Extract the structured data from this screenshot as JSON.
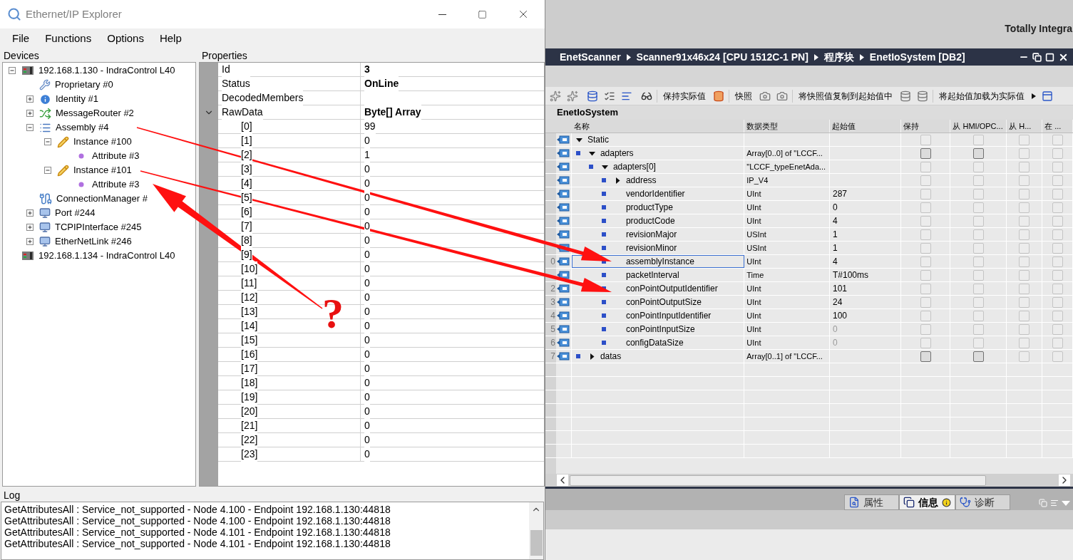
{
  "explorer": {
    "title": "Ethernet/IP Explorer",
    "menu": [
      "File",
      "Functions",
      "Options",
      "Help"
    ],
    "devices_label": "Devices",
    "properties_label": "Properties",
    "tree": [
      {
        "label": "192.168.1.130 - IndraControl L40",
        "kind": "device",
        "expanded": true,
        "children": [
          {
            "label": "Proprietary #0",
            "kind": "wrench"
          },
          {
            "label": "Identity #1",
            "kind": "info",
            "expanded": false
          },
          {
            "label": "MessageRouter #2",
            "kind": "router",
            "expanded": false
          },
          {
            "label": "Assembly #4",
            "kind": "list",
            "expanded": true,
            "children": [
              {
                "label": "Instance #100",
                "kind": "pencil",
                "expanded": true,
                "children": [
                  {
                    "label": "Attribute #3",
                    "kind": "dot"
                  }
                ]
              },
              {
                "label": "Instance #101",
                "kind": "pencil",
                "expanded": true,
                "children": [
                  {
                    "label": "Attribute #3",
                    "kind": "dot"
                  }
                ]
              }
            ]
          },
          {
            "label": "ConnectionManager #",
            "kind": "cable"
          },
          {
            "label": "Port #244",
            "kind": "monitor",
            "expanded": false
          },
          {
            "label": "TCPIPInterface #245",
            "kind": "monitor",
            "expanded": false
          },
          {
            "label": "EtherNetLink #246",
            "kind": "monitor",
            "expanded": false
          }
        ]
      },
      {
        "label": "192.168.1.134 - IndraControl L40",
        "kind": "device"
      }
    ],
    "properties": [
      {
        "name": "Id",
        "value": "3",
        "bold": true
      },
      {
        "name": "Status",
        "value": "OnLine",
        "bold": true
      },
      {
        "name": "DecodedMembers"
      },
      {
        "name": "RawData",
        "value": "Byte[] Array",
        "bold": true,
        "expanded": true,
        "children": [
          {
            "name": "[0]",
            "value": "99"
          },
          {
            "name": "[1]",
            "value": "0"
          },
          {
            "name": "[2]",
            "value": "1"
          },
          {
            "name": "[3]",
            "value": "0"
          },
          {
            "name": "[4]",
            "value": "0"
          },
          {
            "name": "[5]",
            "value": "0"
          },
          {
            "name": "[6]",
            "value": "0"
          },
          {
            "name": "[7]",
            "value": "0"
          },
          {
            "name": "[8]",
            "value": "0"
          },
          {
            "name": "[9]",
            "value": "0"
          },
          {
            "name": "[10]",
            "value": "0"
          },
          {
            "name": "[11]",
            "value": "0"
          },
          {
            "name": "[12]",
            "value": "0"
          },
          {
            "name": "[13]",
            "value": "0"
          },
          {
            "name": "[14]",
            "value": "0"
          },
          {
            "name": "[15]",
            "value": "0"
          },
          {
            "name": "[16]",
            "value": "0"
          },
          {
            "name": "[17]",
            "value": "0"
          },
          {
            "name": "[18]",
            "value": "0"
          },
          {
            "name": "[19]",
            "value": "0"
          },
          {
            "name": "[20]",
            "value": "0"
          },
          {
            "name": "[21]",
            "value": "0"
          },
          {
            "name": "[22]",
            "value": "0"
          },
          {
            "name": "[23]",
            "value": "0"
          }
        ]
      }
    ],
    "log_label": "Log",
    "log": [
      "GetAttributesAll : Service_not_supported - Node 4.100 - Endpoint 192.168.1.130:44818",
      "GetAttributesAll : Service_not_supported - Node 4.100 - Endpoint 192.168.1.130:44818",
      "GetAttributesAll : Service_not_supported - Node 4.101 - Endpoint 192.168.1.130:44818",
      "GetAttributesAll : Service_not_supported - Node 4.101 - Endpoint 192.168.1.130:44818"
    ]
  },
  "tia": {
    "product": "Totally Integra",
    "breadcrumb": [
      "EnetScanner",
      "Scanner91x46x24 [CPU 1512C-1 PN]",
      "程序块",
      "EnetIoSystem [DB2]"
    ],
    "toolbar": [
      "保持实际值",
      "快照",
      "将快照值复制到起始值中",
      "将起始值加载为实际值"
    ],
    "block_title": "EnetIoSystem",
    "columns": [
      "名称",
      "数据类型",
      "起始值",
      "保持",
      "从 HMI/OPC...",
      "从 H...",
      "在 ..."
    ],
    "rows": [
      {
        "name": "Static",
        "expanded": true,
        "selected": false,
        "checked": false,
        "checks_enabled": false,
        "children": [
          {
            "name": "adapters",
            "type": "Array[0..0] of \"LCCF...",
            "expanded": true,
            "selected": false,
            "checked": false,
            "checks_enabled": true,
            "children": [
              {
                "name": "adapters[0]",
                "type": "\"LCCF_typeEnetAda...",
                "expanded": true,
                "selected": false,
                "checked": false,
                "checks_enabled": false,
                "children": [
                  {
                    "name": "address",
                    "type": "IP_V4",
                    "expanded": false,
                    "selected": false,
                    "checked": false,
                    "checks_enabled": false
                  },
                  {
                    "name": "vendorIdentifier",
                    "type": "UInt",
                    "start": "287",
                    "selected": false,
                    "start_greyed": false,
                    "checked": false,
                    "checks_enabled": false
                  },
                  {
                    "name": "productType",
                    "type": "UInt",
                    "start": "0",
                    "selected": false,
                    "start_greyed": false,
                    "checked": false,
                    "checks_enabled": false
                  },
                  {
                    "name": "productCode",
                    "type": "UInt",
                    "start": "4",
                    "selected": false,
                    "start_greyed": false,
                    "checked": false,
                    "checks_enabled": false
                  },
                  {
                    "name": "revisionMajor",
                    "type": "USInt",
                    "start": "1",
                    "selected": false,
                    "start_greyed": false,
                    "checked": false,
                    "checks_enabled": false
                  },
                  {
                    "name": "revisionMinor",
                    "type": "USInt",
                    "start": "1",
                    "selected": false,
                    "start_greyed": false,
                    "checked": false,
                    "checks_enabled": false
                  },
                  {
                    "name": "assemblyInstance",
                    "type": "UInt",
                    "start": "4",
                    "row_number": "0",
                    "selected": true,
                    "start_greyed": false,
                    "checked": false,
                    "checks_enabled": false
                  },
                  {
                    "name": "packetInterval",
                    "type": "Time",
                    "start": "T#100ms",
                    "selected": false,
                    "start_greyed": false,
                    "checked": false,
                    "checks_enabled": false
                  },
                  {
                    "name": "conPointOutputIdentifier",
                    "type": "UInt",
                    "start": "101",
                    "row_number": "2",
                    "selected": false,
                    "start_greyed": false,
                    "checked": false,
                    "checks_enabled": false
                  },
                  {
                    "name": "conPointOutputSize",
                    "type": "UInt",
                    "start": "24",
                    "row_number": "3",
                    "selected": false,
                    "start_greyed": false,
                    "checked": false,
                    "checks_enabled": false
                  },
                  {
                    "name": "conPointInputIdentifier",
                    "type": "UInt",
                    "start": "100",
                    "row_number": "4",
                    "selected": false,
                    "start_greyed": false,
                    "checked": false,
                    "checks_enabled": false
                  },
                  {
                    "name": "conPointInputSize",
                    "type": "UInt",
                    "start": "0",
                    "row_number": "5",
                    "selected": false,
                    "start_greyed": true,
                    "checked": false,
                    "checks_enabled": false
                  },
                  {
                    "name": "configDataSize",
                    "type": "UInt",
                    "start": "0",
                    "row_number": "6",
                    "selected": false,
                    "start_greyed": true,
                    "checked": false,
                    "checks_enabled": false
                  }
                ]
              }
            ]
          },
          {
            "name": "datas",
            "type": "Array[0..1] of \"LCCF...",
            "row_number": "7",
            "expanded": false,
            "selected": false,
            "checked": false,
            "checks_enabled": true
          }
        ]
      }
    ],
    "tabs": [
      {
        "label": "属性",
        "kind": "properties",
        "selected": false
      },
      {
        "label": "信息",
        "kind": "info",
        "selected": true
      },
      {
        "label": "诊断",
        "kind": "diagnostics",
        "selected": false
      }
    ]
  },
  "annotation": {
    "text": "?"
  }
}
